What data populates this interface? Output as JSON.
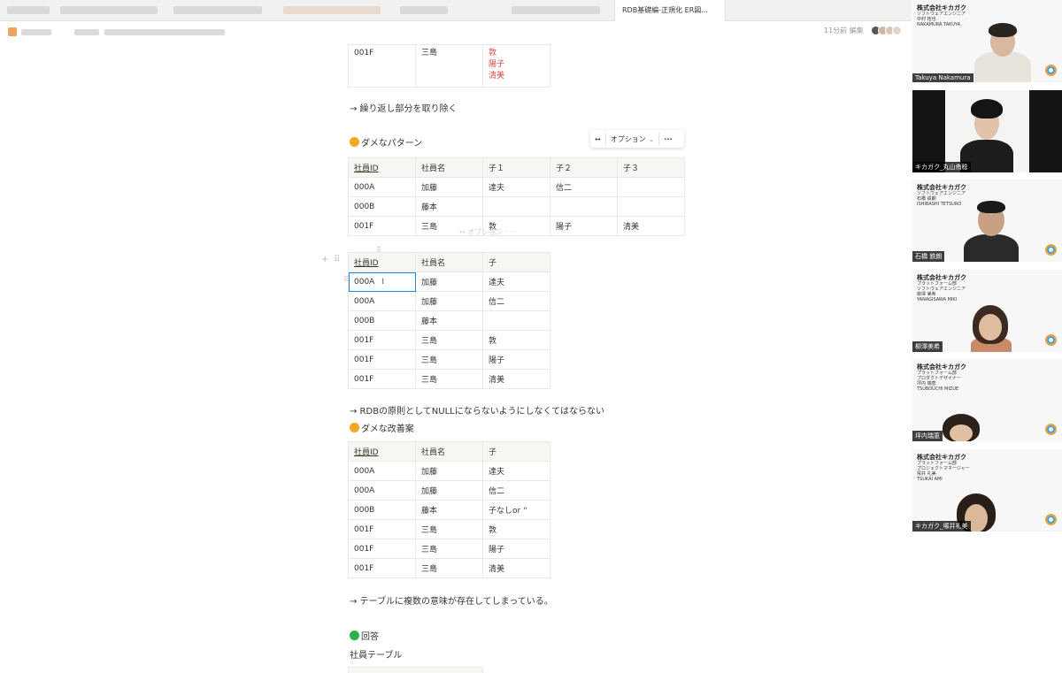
{
  "browser": {
    "active_tab": "RDB基礎編-正規化 ER図..."
  },
  "header": {
    "edited": "11分前 編集"
  },
  "doc": {
    "table0": {
      "rows": [
        [
          "001F",
          "三島",
          [
            "敦",
            "陽子",
            "清美"
          ]
        ]
      ]
    },
    "text_remove_repeat": "→ 繰り返し部分を取り除く",
    "heading_bad_pattern": "ダメなパターン",
    "toolbar": {
      "options_label": "オプション"
    },
    "table1": {
      "headers": [
        "社員ID",
        "社員名",
        "子１",
        "子２",
        "子３"
      ],
      "rows": [
        [
          "000A",
          "加藤",
          "達夫",
          "信二",
          ""
        ],
        [
          "000B",
          "藤本",
          "",
          "",
          ""
        ],
        [
          "001F",
          "三島",
          "敦",
          "陽子",
          "清美"
        ]
      ]
    },
    "ghost_toolbar": "↔  オプション ·  ···",
    "table2": {
      "headers": [
        "社員ID",
        "社員名",
        "子"
      ],
      "rows": [
        [
          "000A",
          "加藤",
          "達夫"
        ],
        [
          "000A",
          "加藤",
          "信二"
        ],
        [
          "000B",
          "藤本",
          ""
        ],
        [
          "001F",
          "三島",
          "敦"
        ],
        [
          "001F",
          "三島",
          "陽子"
        ],
        [
          "001F",
          "三島",
          "清美"
        ]
      ]
    },
    "text_null_rule": "→ RDBの原則としてNULLにならないようにしなくてはならない",
    "heading_bad_fix": "ダメな改善案",
    "table3": {
      "headers": [
        "社員ID",
        "社員名",
        "子"
      ],
      "rows": [
        [
          "000A",
          "加藤",
          "達夫"
        ],
        [
          "000A",
          "加藤",
          "信二"
        ],
        [
          "000B",
          "藤本",
          "子なしor ''"
        ],
        [
          "001F",
          "三島",
          "敦"
        ],
        [
          "001F",
          "三島",
          "陽子"
        ],
        [
          "001F",
          "三島",
          "清美"
        ]
      ]
    },
    "text_multi_meaning": "→ テーブルに複数の意味が存在してしまっている。",
    "heading_answer": "回答",
    "text_employee_table": "社員テーブル"
  },
  "help": "?",
  "participants": [
    {
      "company": "株式会社キカガク",
      "dept": "ソフトウェアエンジニア\n中村 拓也\nNAKAMURA TAKUYA",
      "name": "Takuya Nakamura"
    },
    {
      "company": "",
      "dept": "",
      "name": "キカガク_丸山侑稔"
    },
    {
      "company": "株式会社キカガク",
      "dept": "ソフトウェアエンジニア\n石橋 鉄朗\nISHIBASHI TETSURO",
      "name": "石橋 鉄朗"
    },
    {
      "company": "株式会社キカガク",
      "dept": "プラットフォーム部\nソフトウェアエンジニア\n柳澤 美希\nYANAGISAWA MIKI",
      "name": "柳澤美希"
    },
    {
      "company": "株式会社キカガク",
      "dept": "プラットフォーム部\nプロダクトデザイナー\n坪内 瑞恵\nTSUBOUCHI MIZUE",
      "name": "坪内瑞恵"
    },
    {
      "company": "株式会社キカガク",
      "dept": "プラットフォーム部\nプロジェクトマネージャー\n塚井 礼美\nTSUKAI AMI",
      "name": "キカガク_塚井礼美"
    }
  ],
  "colors": {
    "accent": "#2383e2",
    "red_text": "#d44c47",
    "orange_dot": "#f5a623",
    "green_dot": "#2bb24c"
  }
}
